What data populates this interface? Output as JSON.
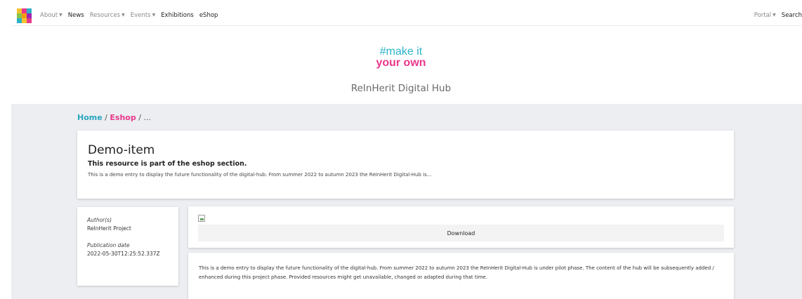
{
  "nav": {
    "items": [
      {
        "label": "About",
        "dropdown": true,
        "style": "muted"
      },
      {
        "label": "News",
        "dropdown": false,
        "style": "dark"
      },
      {
        "label": "Resources",
        "dropdown": true,
        "style": "muted"
      },
      {
        "label": "Events",
        "dropdown": true,
        "style": "muted"
      },
      {
        "label": "Exhibitions",
        "dropdown": false,
        "style": "dark"
      },
      {
        "label": "eShop",
        "dropdown": false,
        "style": "dark"
      }
    ],
    "right": {
      "portal": "Portal",
      "search": "Search"
    },
    "caret": "▼"
  },
  "brand": {
    "line1": "#make it",
    "line2": "your own",
    "color_primary": "#2bb3c9",
    "color_accent": "#e8388b"
  },
  "hub_title": "ReInHerit Digital Hub",
  "breadcrumb": {
    "home": "Home",
    "sep1": " / ",
    "eshop": "Eshop",
    "sep2": " / ...",
    "home_color": "#2ba6bf",
    "eshop_color": "#e8388b"
  },
  "item": {
    "title": "Demo-item",
    "subtitle": "This resource is part of the eshop section.",
    "summary": "This is a demo entry to display the future functionality of the digital-hub. From summer 2022 to autumn 2023 the ReInHerit Digital-Hub is..."
  },
  "meta": {
    "author_label": "Author(s)",
    "author_value": "ReInHerit Project",
    "date_label": "Publication date",
    "date_value": "2022-05-30T12:25:52.337Z"
  },
  "download": {
    "image_icon": "broken-image-icon",
    "label": "Download"
  },
  "body": {
    "text": "This is a demo entry to display the future functionality of the digital-hub. From summer 2022 to autumn 2023 the ReInHerit Digital-Hub is under pilot phase. The content of the hub will be subsequently added / enhanced during this project phase. Provided resources might get unavailable, changed or adapted during that time."
  }
}
